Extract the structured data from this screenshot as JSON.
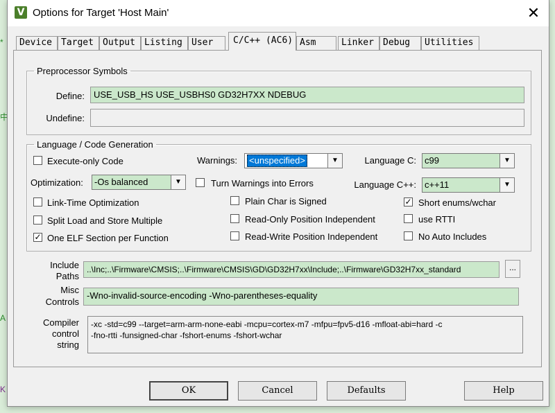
{
  "window": {
    "title": "Options for Target 'Host Main'",
    "app_icon": "V"
  },
  "edge_marks": [
    "*",
    "中",
    "A",
    "K"
  ],
  "tabs": [
    "Device",
    "Target",
    "Output",
    "Listing",
    "User",
    "C/C++ (AC6)",
    "Asm",
    "Linker",
    "Debug",
    "Utilities"
  ],
  "active_tab": "C/C++ (AC6)",
  "preprocessor": {
    "legend": "Preprocessor Symbols",
    "define_label": "Define:",
    "define_value": "USE_USB_HS USE_USBHS0 GD32H7XX NDEBUG",
    "undefine_label": "Undefine:",
    "undefine_value": ""
  },
  "language": {
    "legend": "Language / Code Generation",
    "execute_only": {
      "label": "Execute-only Code",
      "checked": false
    },
    "warnings_label": "Warnings:",
    "warnings_value": "<unspecified>",
    "language_c_label": "Language C:",
    "language_c_value": "c99",
    "optimization_label": "Optimization:",
    "optimization_value": "-Os balanced",
    "turn_warnings": {
      "label": "Turn Warnings into Errors",
      "checked": false
    },
    "language_cpp_label": "Language C++:",
    "language_cpp_value": "c++11",
    "link_time": {
      "label": "Link-Time Optimization",
      "checked": false
    },
    "plain_char": {
      "label": "Plain Char is Signed",
      "checked": false
    },
    "short_enums": {
      "label": "Short enums/wchar",
      "checked": true
    },
    "split_load": {
      "label": "Split Load and Store Multiple",
      "checked": false
    },
    "ro_pos": {
      "label": "Read-Only Position Independent",
      "checked": false
    },
    "use_rtti": {
      "label": "use RTTI",
      "checked": false
    },
    "one_elf": {
      "label": "One ELF Section per Function",
      "checked": true
    },
    "rw_pos": {
      "label": "Read-Write Position Independent",
      "checked": false
    },
    "no_auto": {
      "label": "No Auto Includes",
      "checked": false
    }
  },
  "include": {
    "label_line1": "Include",
    "label_line2": "Paths",
    "value": "..\\Inc;..\\Firmware\\CMSIS;..\\Firmware\\CMSIS\\GD\\GD32H7xx\\Include;..\\Firmware\\GD32H7xx_standard",
    "browse_label": "..."
  },
  "misc": {
    "label_line1": "Misc",
    "label_line2": "Controls",
    "value": "-Wno-invalid-source-encoding -Wno-parentheses-equality"
  },
  "compiler": {
    "label_line1": "Compiler",
    "label_line2": "control",
    "label_line3": "string",
    "line1": "-xc -std=c99 --target=arm-arm-none-eabi -mcpu=cortex-m7 -mfpu=fpv5-d16 -mfloat-abi=hard -c",
    "line2": "-fno-rtti -funsigned-char -fshort-enums -fshort-wchar"
  },
  "buttons": {
    "ok": "OK",
    "cancel": "Cancel",
    "defaults": "Defaults",
    "help": "Help"
  },
  "colors": {
    "field_bg": "#cbe8cb",
    "selection": "#0078d7",
    "desktop": "#d9ecd8"
  }
}
